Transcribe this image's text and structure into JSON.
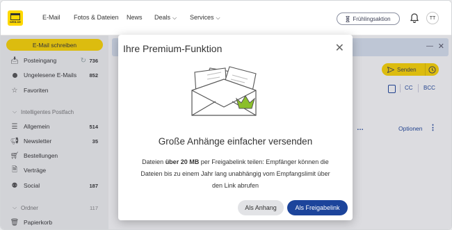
{
  "header": {
    "logo_text": "WEB.DE",
    "nav": [
      {
        "label": "E-Mail",
        "has_chevron": false
      },
      {
        "label": "Fotos & Dateien",
        "has_chevron": false
      },
      {
        "label": "News",
        "has_chevron": false
      },
      {
        "label": "Deals",
        "has_chevron": true
      },
      {
        "label": "Services",
        "has_chevron": true
      }
    ],
    "promo_label": "Frühlingsaktion",
    "avatar_initials": "TT"
  },
  "sidebar": {
    "compose_label": "E-Mail schreiben",
    "items": [
      {
        "label": "Posteingang",
        "count": "736",
        "icon": "inbox-icon"
      },
      {
        "label": "Ungelesene E-Mails",
        "count": "852",
        "icon": "unread-dot-icon"
      },
      {
        "label": "Favoriten",
        "count": "",
        "icon": "star-icon"
      },
      {
        "label": "Intelligentes Postfach",
        "count": "",
        "icon": "chevron-down-icon",
        "section": true
      },
      {
        "label": "Allgemein",
        "count": "514",
        "icon": "list-icon"
      },
      {
        "label": "Newsletter",
        "count": "35",
        "icon": "megaphone-icon"
      },
      {
        "label": "Bestellungen",
        "count": "",
        "icon": "cart-icon"
      },
      {
        "label": "Verträge",
        "count": "",
        "icon": "document-icon"
      },
      {
        "label": "Social",
        "count": "187",
        "icon": "social-icon"
      },
      {
        "label": "Ordner",
        "count": "117",
        "icon": "chevron-down-icon",
        "section": true
      },
      {
        "label": "Papierkorb",
        "count": "",
        "icon": "trash-icon"
      }
    ]
  },
  "compose": {
    "send_label": "Senden",
    "cc_label": "CC",
    "bcc_label": "BCC",
    "options_label": "Optionen"
  },
  "modal": {
    "title": "Ihre Premium-Funktion",
    "headline": "Große Anhänge einfacher versenden",
    "desc_prefix": "Dateien ",
    "desc_bold": "über 20 MB",
    "desc_suffix": " per Freigabelink teilen: Empfänger können die Dateien bis zu einem Jahr lang unabhängig vom Empfangslimit über den Link abrufen",
    "secondary_button": "Als Anhang",
    "primary_button": "Als Freigabelink"
  },
  "colors": {
    "brand_yellow": "#ffd800",
    "primary_blue": "#1c449b",
    "illustration_green": "#8bbf2a"
  }
}
